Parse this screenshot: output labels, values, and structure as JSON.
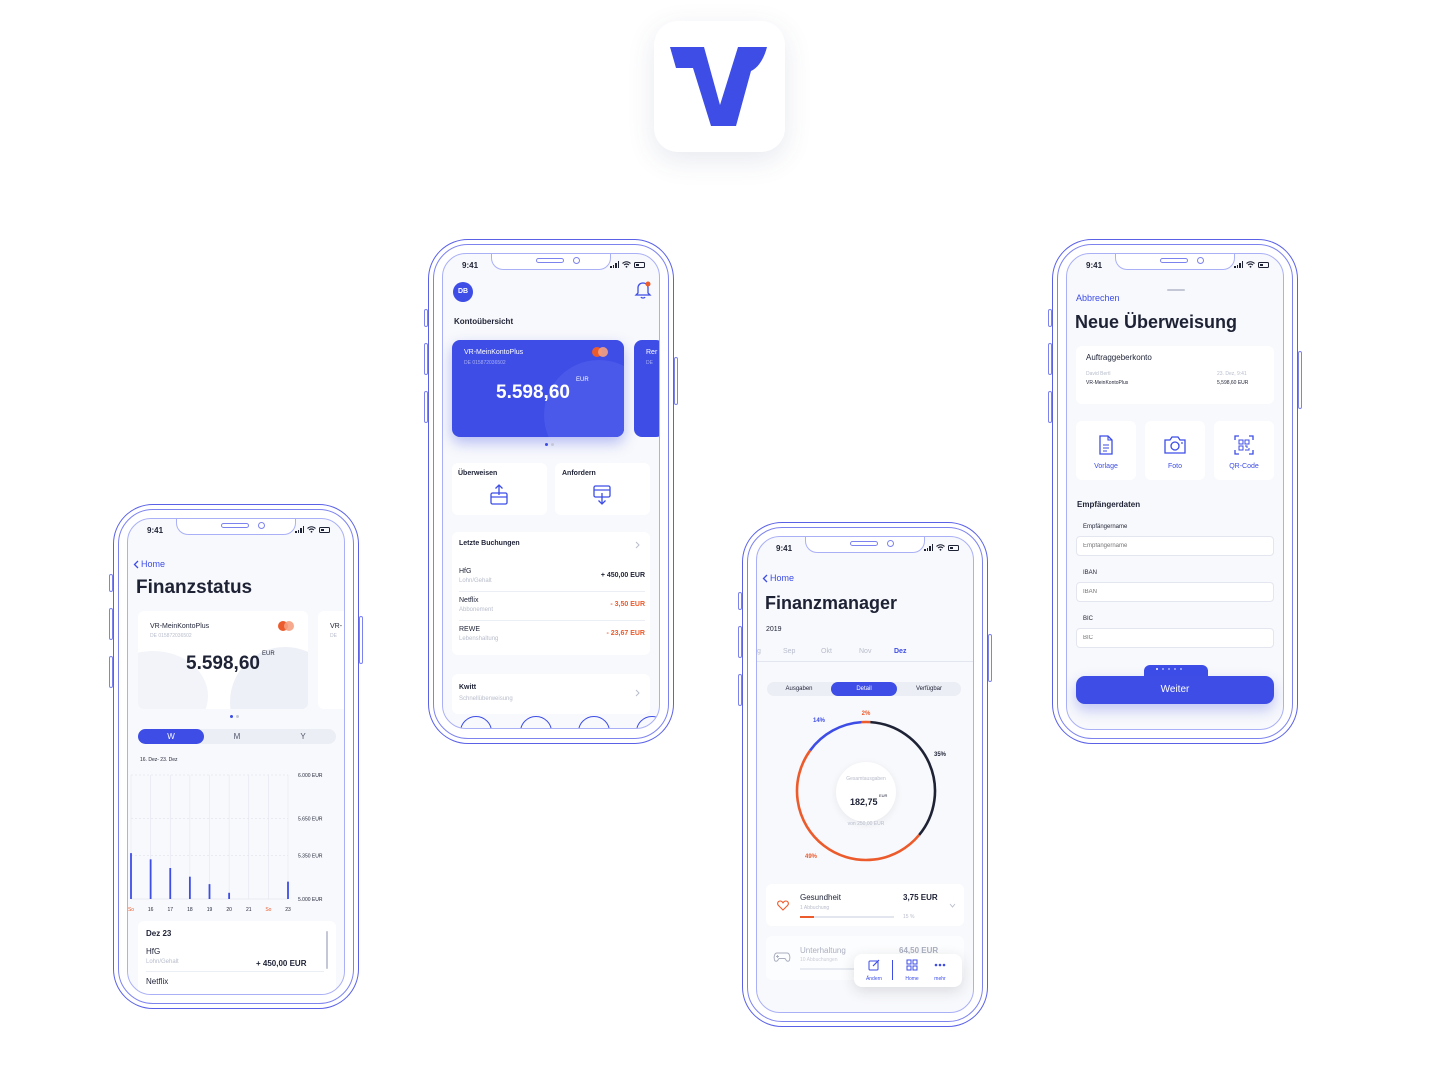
{
  "colors": {
    "primary": "#3d4de6",
    "accent_red": "#ec5b2c",
    "dark": "#1e2235",
    "muted": "#b9bdcc",
    "outline": "#5a61e6"
  },
  "logo": {
    "icon": "vr-logo"
  },
  "status": {
    "time": "9:41"
  },
  "phone1": {
    "back": "Home",
    "title": "Finanzstatus",
    "card": {
      "name": "VR-MeinKontoPlus",
      "iban": "DE 015872036502",
      "amount": "5.598,60",
      "currency": "EUR",
      "peek": "VR-",
      "peek_sub": "DE"
    },
    "segments": [
      "W",
      "M",
      "Y"
    ],
    "range": "16. Dez- 23. Dez",
    "y_ticks": [
      "6.000 EUR",
      "5.650 EUR",
      "5.350 EUR",
      "5.000 EUR"
    ],
    "x_ticks": [
      "So",
      "16",
      "17",
      "18",
      "19",
      "20",
      "21",
      "So",
      "23"
    ],
    "bar_values": [
      5370,
      5320,
      5250,
      5180,
      5120,
      5050,
      4950,
      4900,
      5140
    ],
    "list": {
      "header": "Dez 23",
      "item1_name": "HfG",
      "item1_sub": "Lohn/Gehalt",
      "item1_amount": "+ 450,00 EUR",
      "item2_name": "Netflix"
    }
  },
  "phone2": {
    "avatar": "DB",
    "section": "Kontoübersicht",
    "card": {
      "name": "VR-MeinKontoPlus",
      "iban": "DE 015872036502",
      "amount": "5.598,60",
      "currency": "EUR",
      "peek": "Rer",
      "peek_sub": "DE"
    },
    "actions": {
      "transfer": "Überweisen",
      "request": "Anfordern"
    },
    "bookings": {
      "title": "Letzte Buchungen",
      "rows": [
        {
          "name": "HfG",
          "sub": "Lohn/Gehalt",
          "amount": "+ 450,00 EUR"
        },
        {
          "name": "Netflix",
          "sub": "Abbonement",
          "amount": "- 3,50 EUR"
        },
        {
          "name": "REWE",
          "sub": "Lebenshaltung",
          "amount": "- 23,67 EUR"
        }
      ]
    },
    "kwitt": {
      "title": "Kwitt",
      "sub": "Schnellüberweisung"
    }
  },
  "phone3": {
    "back": "Home",
    "title": "Finanzmanager",
    "year": "2019",
    "months": [
      "g",
      "Sep",
      "Okt",
      "Nov",
      "Dez"
    ],
    "tabs": [
      "Ausgaben",
      "Detail",
      "Verfügbar"
    ],
    "donut": {
      "center_label": "Gesamtausgaben",
      "center_value": "182,75",
      "center_currency": "EUR",
      "center_sub": "von 250,00 EUR",
      "segments": [
        {
          "label": "2%",
          "value": 2,
          "color": "#ec5b2c"
        },
        {
          "label": "35%",
          "value": 35,
          "color": "#1e2235"
        },
        {
          "label": "49%",
          "value": 49,
          "color": "#ec5b2c"
        },
        {
          "label": "14%",
          "value": 14,
          "color": "#3d4de6"
        }
      ]
    },
    "categories": [
      {
        "name": "Gesundheit",
        "sub": "1 Abbuchung",
        "amount": "3,75 EUR",
        "percent": "15 %",
        "icon": "heart-icon"
      },
      {
        "name": "Unterhaltung",
        "sub": "10 Abbuchungen",
        "amount": "64,50 EUR",
        "icon": "gamepad-icon"
      }
    ],
    "dock": {
      "edit": "Ändern",
      "home": "Home",
      "more": "mehr"
    }
  },
  "phone4": {
    "cancel": "Abbrechen",
    "title": "Neue Überweisung",
    "payer": {
      "title": "Auftraggeberkonto",
      "name": "David Bertl",
      "account": "VR-MeinKontoPlus",
      "date": "23. Dez, 9:41",
      "amount": "5,598,60 EUR"
    },
    "options": [
      {
        "label": "Vorlage",
        "icon": "document-icon"
      },
      {
        "label": "Foto",
        "icon": "camera-icon"
      },
      {
        "label": "QR-Code",
        "icon": "qr-code-icon"
      }
    ],
    "recipient": {
      "title": "Empfängerdaten",
      "fields": [
        {
          "label": "Empfängername",
          "placeholder": "Empfängername"
        },
        {
          "label": "IBAN",
          "placeholder": "IBAN"
        },
        {
          "label": "BIC",
          "placeholder": "BIC"
        }
      ]
    },
    "next": "Weiter"
  }
}
